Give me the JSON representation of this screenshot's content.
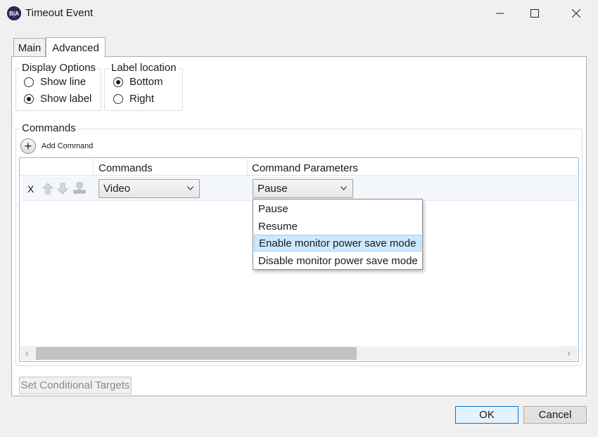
{
  "window": {
    "title": "Timeout Event",
    "app_icon_text": "B|A",
    "minimize": "—",
    "maximize": "☐",
    "close": "✕"
  },
  "tabs": [
    {
      "label": "Main",
      "active": false
    },
    {
      "label": "Advanced",
      "active": true
    }
  ],
  "display_options": {
    "title": "Display Options",
    "options": [
      {
        "label": "Show line",
        "checked": false
      },
      {
        "label": "Show label",
        "checked": true
      }
    ]
  },
  "label_location": {
    "title": "Label location",
    "options": [
      {
        "label": "Bottom",
        "checked": true
      },
      {
        "label": "Right",
        "checked": false
      }
    ]
  },
  "commands_group": {
    "title": "Commands",
    "add_label": "Add Command",
    "columns": [
      "Commands",
      "Command Parameters"
    ],
    "rows": [
      {
        "delete": "X",
        "command": "Video",
        "parameter": "Pause"
      }
    ]
  },
  "param_dropdown": {
    "options": [
      "Pause",
      "Resume",
      "Enable monitor power save mode",
      "Disable monitor power save mode"
    ],
    "selected": "Pause",
    "highlighted": "Enable monitor power save mode"
  },
  "scrollbar": {
    "left_arrow": "‹",
    "right_arrow": "›"
  },
  "buttons": {
    "set_conditional_targets": "Set Conditional Targets",
    "ok": "OK",
    "cancel": "Cancel"
  },
  "colors": {
    "highlight": "#cce8ff",
    "default_button_border": "#0078d7",
    "app_icon": "#2e2a5c"
  }
}
